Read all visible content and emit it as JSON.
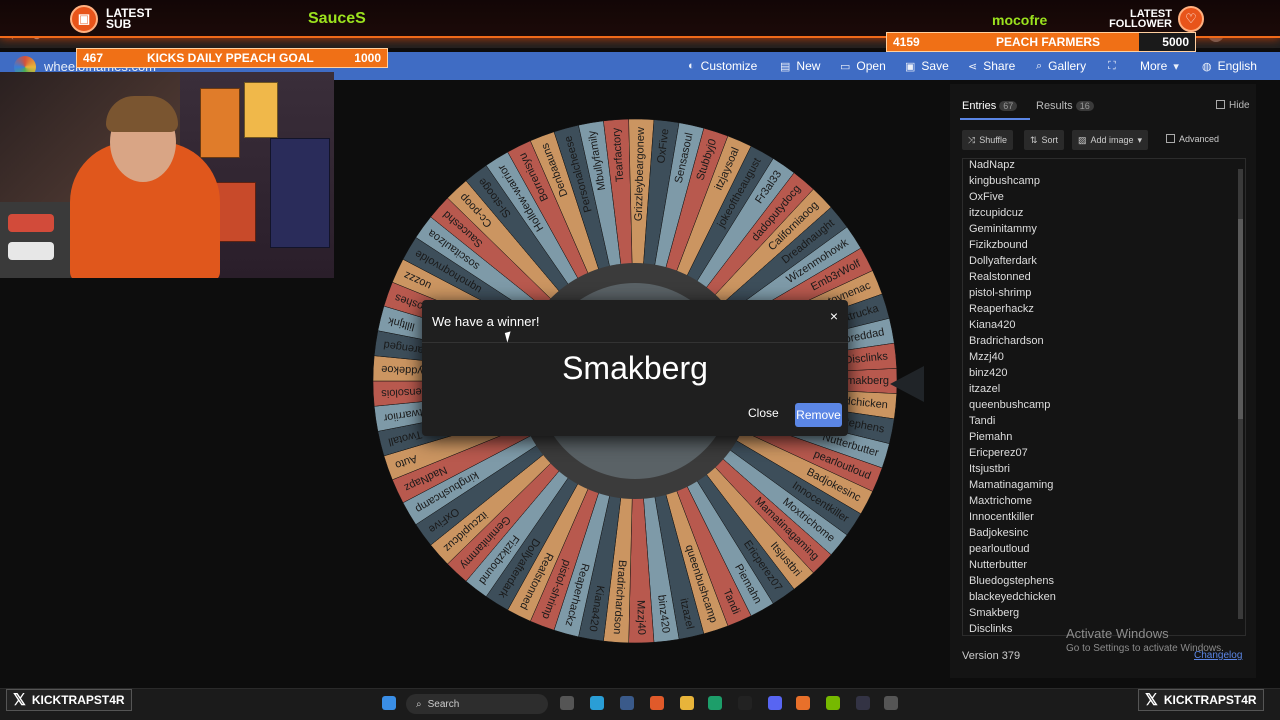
{
  "overlay": {
    "latest_sub_label": "LATEST\nSUB",
    "latest_follower_label": "LATEST\nFOLLOWER",
    "sponsor_left": "SauceS",
    "sponsor_right": "mocofre"
  },
  "goals": {
    "left": {
      "current": "467",
      "label": "KICKS DAILY PPEACH GOAL",
      "target": "1000"
    },
    "right": {
      "current": "4159",
      "label": "PEACH FARMERS",
      "target": "5000"
    }
  },
  "app": {
    "title": "wheelofnames.com",
    "menu": [
      "Customize",
      "New",
      "Open",
      "Save",
      "Share",
      "Gallery",
      "",
      "More",
      "English"
    ]
  },
  "dialog": {
    "title": "We have a winner!",
    "winner": "Smakberg",
    "close_label": "Close",
    "remove_label": "Remove",
    "close_icon": "×"
  },
  "panel": {
    "tabs": [
      {
        "label": "Entries",
        "count": "67"
      },
      {
        "label": "Results",
        "count": "16"
      }
    ],
    "hide_label": "Hide",
    "tools": {
      "shuffle": "Shuffle",
      "sort": "Sort",
      "add_image": "Add image",
      "advanced": "Advanced"
    },
    "entries": [
      "NadNapz",
      "kingbushcamp",
      "OxFive",
      "itzcupidcuz",
      "Geminitammy",
      "Fizikzbound",
      "Dollyafterdark",
      "Realstonned",
      "pistol-shrimp",
      "Reaperhackz",
      "Kiana420",
      "Bradrichardson",
      "Mzzj40",
      "binz420",
      "itzazel",
      "queenbushcamp",
      "Tandi",
      "Piemahn",
      "Ericperez07",
      "Itsjustbri",
      "Mamatinagaming",
      "Maxtrichome",
      "Innocentkiller",
      "Badjokesinc",
      "pearloutloud",
      "Nutterbutter",
      "Bluedogstephens",
      "blackeyedchicken",
      "Smakberg",
      "Disclinks"
    ],
    "version": "Version 379",
    "changelog": "Changelog"
  },
  "windows": {
    "activate_title": "Activate Windows",
    "activate_sub": "Go to Settings to activate Windows."
  },
  "taskbar": {
    "search_placeholder": "Search",
    "x_handle": "KICKTRAPST4R"
  },
  "wheel": {
    "colors": [
      "#b8594e",
      "#cb9561",
      "#3d4e5a",
      "#7e9aa8"
    ],
    "segments": [
      "Smakberg",
      "blackeyedchicken",
      "Bluedogstephens",
      "Nutterbutter",
      "pearloutloud",
      "Badjokesinc",
      "Innocentkiller",
      "Moxtrichome",
      "Mamatinagaming",
      "Itsjustbri",
      "Ericperez07",
      "Piemahn",
      "Tandi",
      "queenbushcamp",
      "itzazel",
      "binz420",
      "Mzzj40",
      "Bradrichardson",
      "Kiana420",
      "Reaperhackz",
      "pistol-shrimp",
      "Realstonned",
      "Dollyafterdark",
      "Fizikzbound",
      "Geminitammy",
      "itzcupidcuz",
      "OxFive",
      "kingbushcamp",
      "NadNapz",
      "Auto",
      "Twotall",
      "Iltwarriior",
      "Ikensolois",
      "jyddekoe",
      "Iffarenged",
      "lilltjnk",
      "lfroshes",
      "uozzz",
      "uqnohoqnvolde",
      "soscitaulzoa",
      "Sauceshd",
      "Cc-poop",
      "Sl-stooge",
      "Holldew-warrior",
      "Borrenisyu",
      "Denbaauns",
      "Personalcheese",
      "Mbullyfamily",
      "Tearfactory",
      "Grizzleybeargonew",
      "OxFive",
      "Sensasoul",
      "Stubbyj0",
      "itzjaysoal",
      "jokeoftheaugust",
      "Fr3al33",
      "dadoputydocg",
      "Californiaoog",
      "Dreadnaught",
      "Wizenmohowk",
      "Emb3rWolf",
      "tovnenac",
      "cluttrucka",
      "Lyporeddad",
      "Disclinks"
    ]
  }
}
